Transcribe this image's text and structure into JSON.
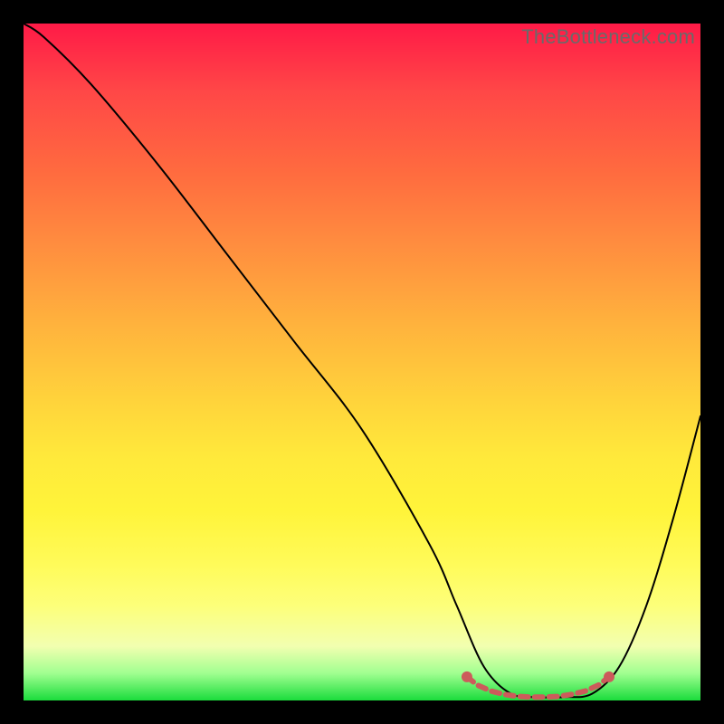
{
  "watermark": "TheBottleneck.com",
  "chart_data": {
    "type": "line",
    "title": "",
    "xlabel": "",
    "ylabel": "",
    "xlim": [
      0,
      100
    ],
    "ylim": [
      0,
      100
    ],
    "series": [
      {
        "name": "curve",
        "x": [
          0,
          3,
          10,
          20,
          30,
          40,
          50,
          60,
          64,
          68,
          72,
          76,
          80,
          84,
          88,
          92,
          96,
          100
        ],
        "values": [
          100,
          98,
          91,
          79,
          66,
          53,
          40,
          23,
          14,
          5,
          1,
          0.5,
          0.5,
          1,
          5,
          14,
          27,
          42
        ]
      }
    ],
    "markers": {
      "name": "bottom-band",
      "color": "#cc5b5b",
      "points": [
        {
          "x": 65.5,
          "y": 3.5
        },
        {
          "x": 67,
          "y": 2.3
        },
        {
          "x": 69,
          "y": 1.4
        },
        {
          "x": 71,
          "y": 0.9
        },
        {
          "x": 73,
          "y": 0.6
        },
        {
          "x": 75,
          "y": 0.5
        },
        {
          "x": 77,
          "y": 0.5
        },
        {
          "x": 79,
          "y": 0.6
        },
        {
          "x": 81,
          "y": 0.9
        },
        {
          "x": 83,
          "y": 1.4
        },
        {
          "x": 85,
          "y": 2.3
        },
        {
          "x": 86.5,
          "y": 3.5
        }
      ]
    }
  }
}
